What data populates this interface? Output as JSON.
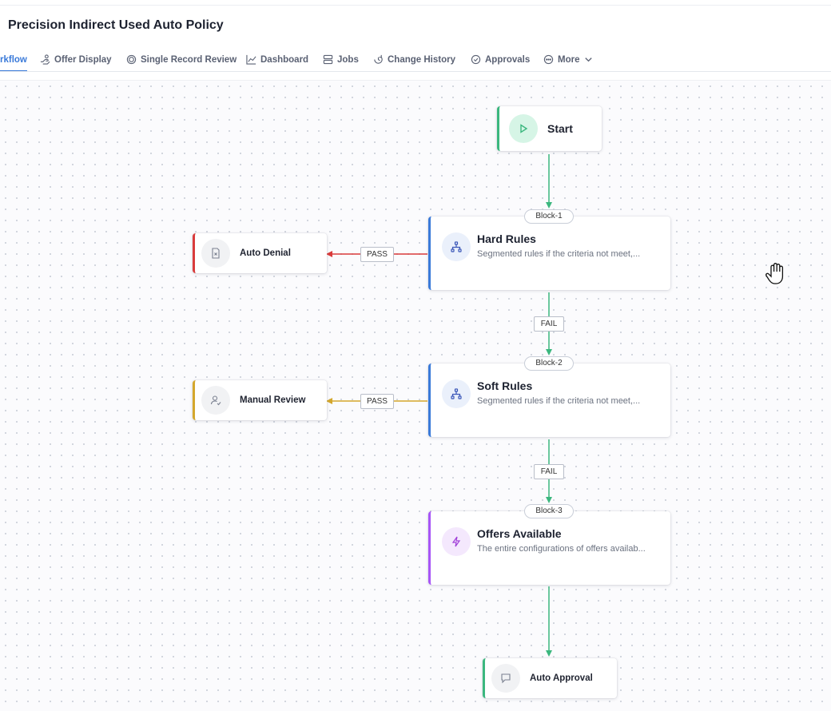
{
  "header": {
    "title": "Precision Indirect Used Auto Policy"
  },
  "tabs": [
    {
      "label": "rkflow",
      "icon": "workflow-icon",
      "active": true
    },
    {
      "label": "Offer Display",
      "icon": "offer-icon"
    },
    {
      "label": "Single Record Review",
      "icon": "record-icon"
    },
    {
      "label": "Dashboard",
      "icon": "chart-icon"
    },
    {
      "label": "Jobs",
      "icon": "jobs-icon"
    },
    {
      "label": "Change History",
      "icon": "history-icon"
    },
    {
      "label": "Approvals",
      "icon": "check-circle-icon"
    },
    {
      "label": "More",
      "icon": "more-icon"
    }
  ],
  "flow": {
    "start": {
      "label": "Start",
      "color": "#3bb77e"
    },
    "blocks": [
      {
        "badge": "Block-1",
        "title": "Hard Rules",
        "desc": "Segmented rules if the criteria not meet,...",
        "icon": "hierarchy-icon",
        "accent": "#3a7ad9"
      },
      {
        "badge": "Block-2",
        "title": "Soft Rules",
        "desc": "Segmented rules if the criteria not meet,...",
        "icon": "hierarchy-icon",
        "accent": "#3a7ad9"
      },
      {
        "badge": "Block-3",
        "title": "Offers Available",
        "desc": "The entire configurations of offers availab...",
        "icon": "lightning-icon",
        "accent": "#a855f7"
      }
    ],
    "outcomes": [
      {
        "label": "Auto Denial",
        "icon": "document-x-icon",
        "accent": "#d93b3b"
      },
      {
        "label": "Manual Review",
        "icon": "user-check-icon",
        "accent": "#d4a72c"
      },
      {
        "label": "Auto Approval",
        "icon": "approval-icon",
        "accent": "#3bb77e"
      }
    ],
    "edge_labels": {
      "pass": "PASS",
      "fail": "FAIL"
    }
  },
  "colors": {
    "accent": "#3a7ad9",
    "success": "#3bb77e",
    "danger": "#d93b3b",
    "warning": "#d4a72c",
    "purple": "#a855f7"
  }
}
